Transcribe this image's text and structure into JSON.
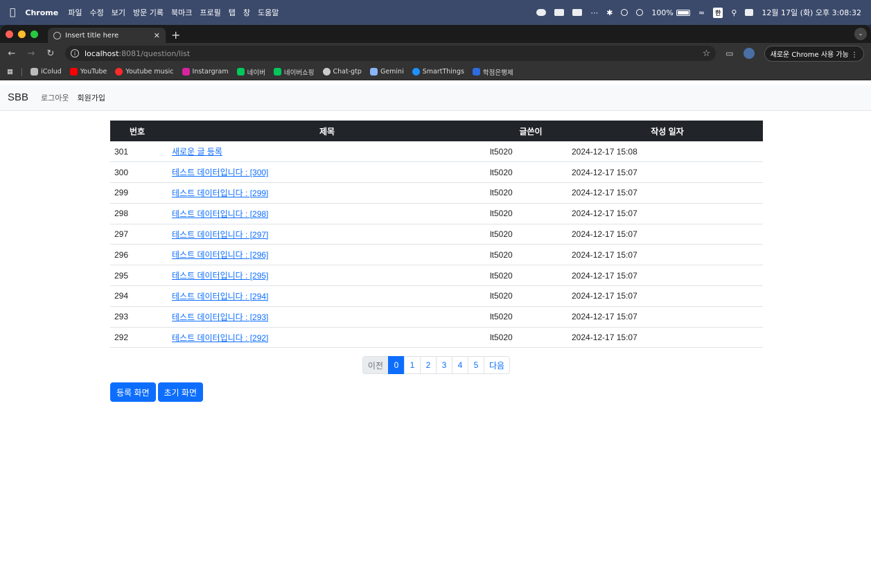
{
  "menubar": {
    "app_name": "Chrome",
    "items": [
      "파일",
      "수정",
      "보기",
      "방문 기록",
      "북마크",
      "프로필",
      "탭",
      "창",
      "도움말"
    ],
    "battery": "100%",
    "input_source": "한",
    "clock": "12월 17일 (화) 오후 3:08:32"
  },
  "browser": {
    "tab_title": "Insert title here",
    "url_host": "localhost",
    "url_path": ":8081/question/list",
    "upgrade_label": "새로운 Chrome 사용 가능",
    "bookmarks": [
      {
        "label": "iColud",
        "color": "#bbbbbb"
      },
      {
        "label": "YouTube",
        "color": "#ff0000"
      },
      {
        "label": "Youtube music",
        "color": "#ff2a2a"
      },
      {
        "label": "Instargram",
        "color": "#d6249f"
      },
      {
        "label": "네이버",
        "color": "#03c75a"
      },
      {
        "label": "네이버쇼핑",
        "color": "#03c75a"
      },
      {
        "label": "Chat-gtp",
        "color": "#cccccc"
      },
      {
        "label": "Gemini",
        "color": "#8ab4f8"
      },
      {
        "label": "SmartThings",
        "color": "#1e90ff"
      },
      {
        "label": "학점은행제",
        "color": "#2d6cdf"
      }
    ]
  },
  "navbar": {
    "brand": "SBB",
    "logout": "로그아웃",
    "signup": "회원가입"
  },
  "table": {
    "headers": {
      "num": "번호",
      "title": "제목",
      "author": "글쓴이",
      "date": "작성 일자"
    },
    "rows": [
      {
        "num": "301",
        "title": "새로운 글 등록",
        "author": "lt5020",
        "date": "2024-12-17 15:08"
      },
      {
        "num": "300",
        "title": "테스트 데이터입니다 : [300]",
        "author": "lt5020",
        "date": "2024-12-17 15:07"
      },
      {
        "num": "299",
        "title": "테스트 데이터입니다 : [299]",
        "author": "lt5020",
        "date": "2024-12-17 15:07"
      },
      {
        "num": "298",
        "title": "테스트 데이터입니다 : [298]",
        "author": "lt5020",
        "date": "2024-12-17 15:07"
      },
      {
        "num": "297",
        "title": "테스트 데이터입니다 : [297]",
        "author": "lt5020",
        "date": "2024-12-17 15:07"
      },
      {
        "num": "296",
        "title": "테스트 데이터입니다 : [296]",
        "author": "lt5020",
        "date": "2024-12-17 15:07"
      },
      {
        "num": "295",
        "title": "테스트 데이터입니다 : [295]",
        "author": "lt5020",
        "date": "2024-12-17 15:07"
      },
      {
        "num": "294",
        "title": "테스트 데이터입니다 : [294]",
        "author": "lt5020",
        "date": "2024-12-17 15:07"
      },
      {
        "num": "293",
        "title": "테스트 데이터입니다 : [293]",
        "author": "lt5020",
        "date": "2024-12-17 15:07"
      },
      {
        "num": "292",
        "title": "테스트 데이터입니다 : [292]",
        "author": "lt5020",
        "date": "2024-12-17 15:07"
      }
    ]
  },
  "pagination": {
    "prev": "이전",
    "pages": [
      "0",
      "1",
      "2",
      "3",
      "4",
      "5"
    ],
    "current": "0",
    "next": "다음"
  },
  "actions": {
    "register": "등록 화면",
    "home": "초기 화면"
  },
  "colors": {
    "primary": "#0d6efd",
    "table_header": "#212529",
    "close_dot": "#ff5f57",
    "minimize_dot": "#febc2e",
    "maximize_dot": "#28c840"
  }
}
